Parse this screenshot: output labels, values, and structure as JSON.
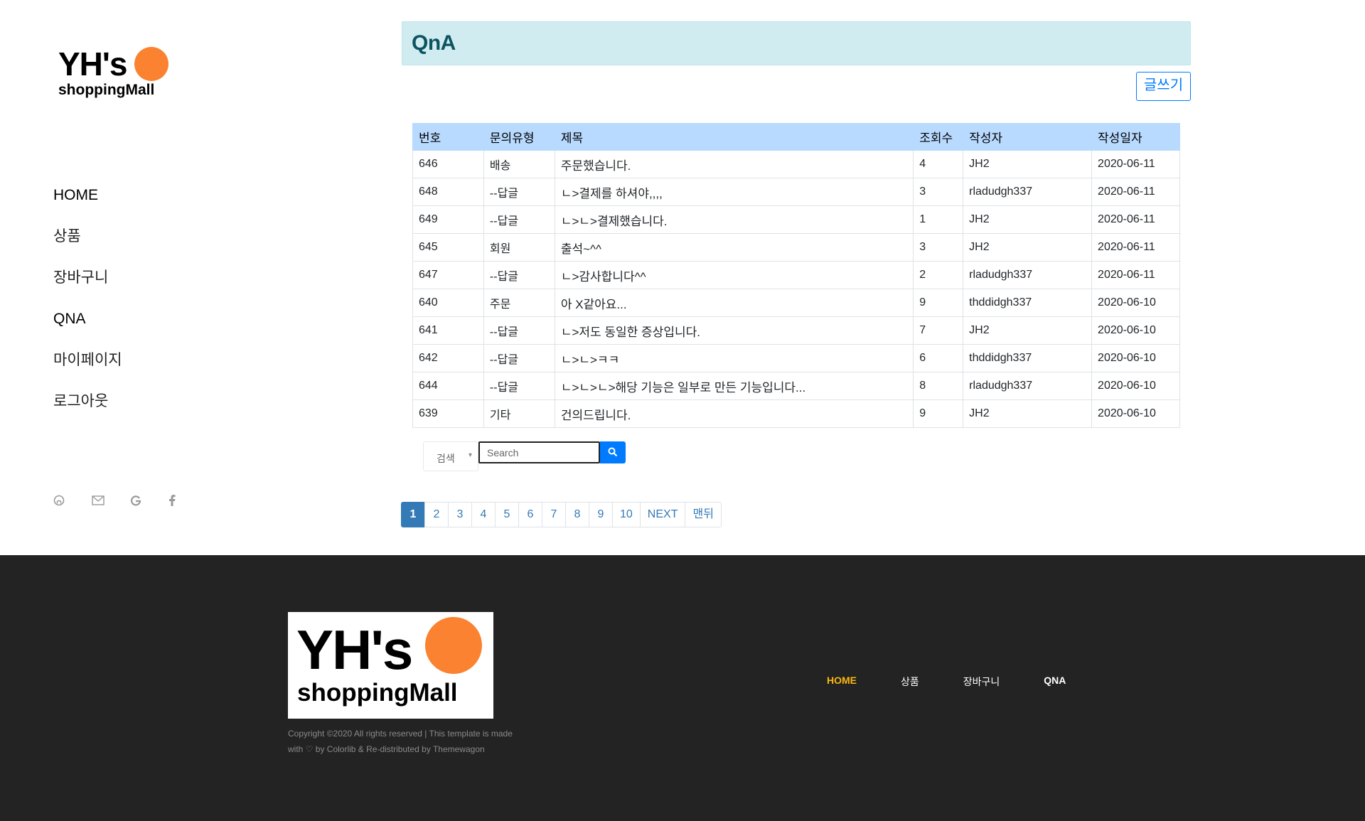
{
  "brand": {
    "logo_top": "YH's",
    "logo_bottom": "shoppingMall",
    "accent": "#fa8231"
  },
  "sidebar": {
    "nav": [
      {
        "label": "HOME"
      },
      {
        "label": "상품"
      },
      {
        "label": "장바구니"
      },
      {
        "label": "QNA"
      },
      {
        "label": "마이페이지"
      },
      {
        "label": "로그아웃"
      }
    ],
    "social_icons": [
      "github-icon",
      "envelope-icon",
      "google-icon",
      "facebook-icon"
    ]
  },
  "main": {
    "title": "QnA",
    "write_button": "글쓰기",
    "table": {
      "headers": [
        "번호",
        "문의유형",
        "제목",
        "조회수",
        "작성자",
        "작성일자"
      ],
      "rows": [
        [
          "646",
          "배송",
          "주문했습니다.",
          "4",
          "JH2",
          "2020-06-11"
        ],
        [
          "648",
          "--답글",
          "ㄴ>결제를 하셔야,,,,",
          "3",
          "rladudgh337",
          "2020-06-11"
        ],
        [
          "649",
          "--답글",
          "ㄴ>ㄴ>결제했습니다.",
          "1",
          "JH2",
          "2020-06-11"
        ],
        [
          "645",
          "회원",
          "출석~^^",
          "3",
          "JH2",
          "2020-06-11"
        ],
        [
          "647",
          "--답글",
          "ㄴ>감사합니다^^",
          "2",
          "rladudgh337",
          "2020-06-11"
        ],
        [
          "640",
          "주문",
          "아 X같아요...",
          "9",
          "thddidgh337",
          "2020-06-10"
        ],
        [
          "641",
          "--답글",
          "ㄴ>저도 동일한 증상입니다.",
          "7",
          "JH2",
          "2020-06-10"
        ],
        [
          "642",
          "--답글",
          "ㄴ>ㄴ>ㅋㅋ",
          "6",
          "thddidgh337",
          "2020-06-10"
        ],
        [
          "644",
          "--답글",
          "ㄴ>ㄴ>ㄴ>해당 기능은 일부로 만든 기능입니다...",
          "8",
          "rladudgh337",
          "2020-06-10"
        ],
        [
          "639",
          "기타",
          "건의드립니다.",
          "9",
          "JH2",
          "2020-06-10"
        ]
      ]
    },
    "search": {
      "select_value": "검색",
      "placeholder": "Search"
    },
    "pagination": [
      "1",
      "2",
      "3",
      "4",
      "5",
      "6",
      "7",
      "8",
      "9",
      "10",
      "NEXT",
      "맨뒤"
    ],
    "current_page": "1"
  },
  "footer": {
    "copyright_line1": "Copyright ©2020 All rights reserved | This template is made",
    "copyright_line2": "with ♡ by Colorlib & Re-distributed by Themewagon",
    "nav": [
      {
        "label": "HOME",
        "active": true
      },
      {
        "label": "상품"
      },
      {
        "label": "장바구니"
      },
      {
        "label": "QNA"
      }
    ],
    "bg": "#232323",
    "active_color": "#fbb710"
  }
}
